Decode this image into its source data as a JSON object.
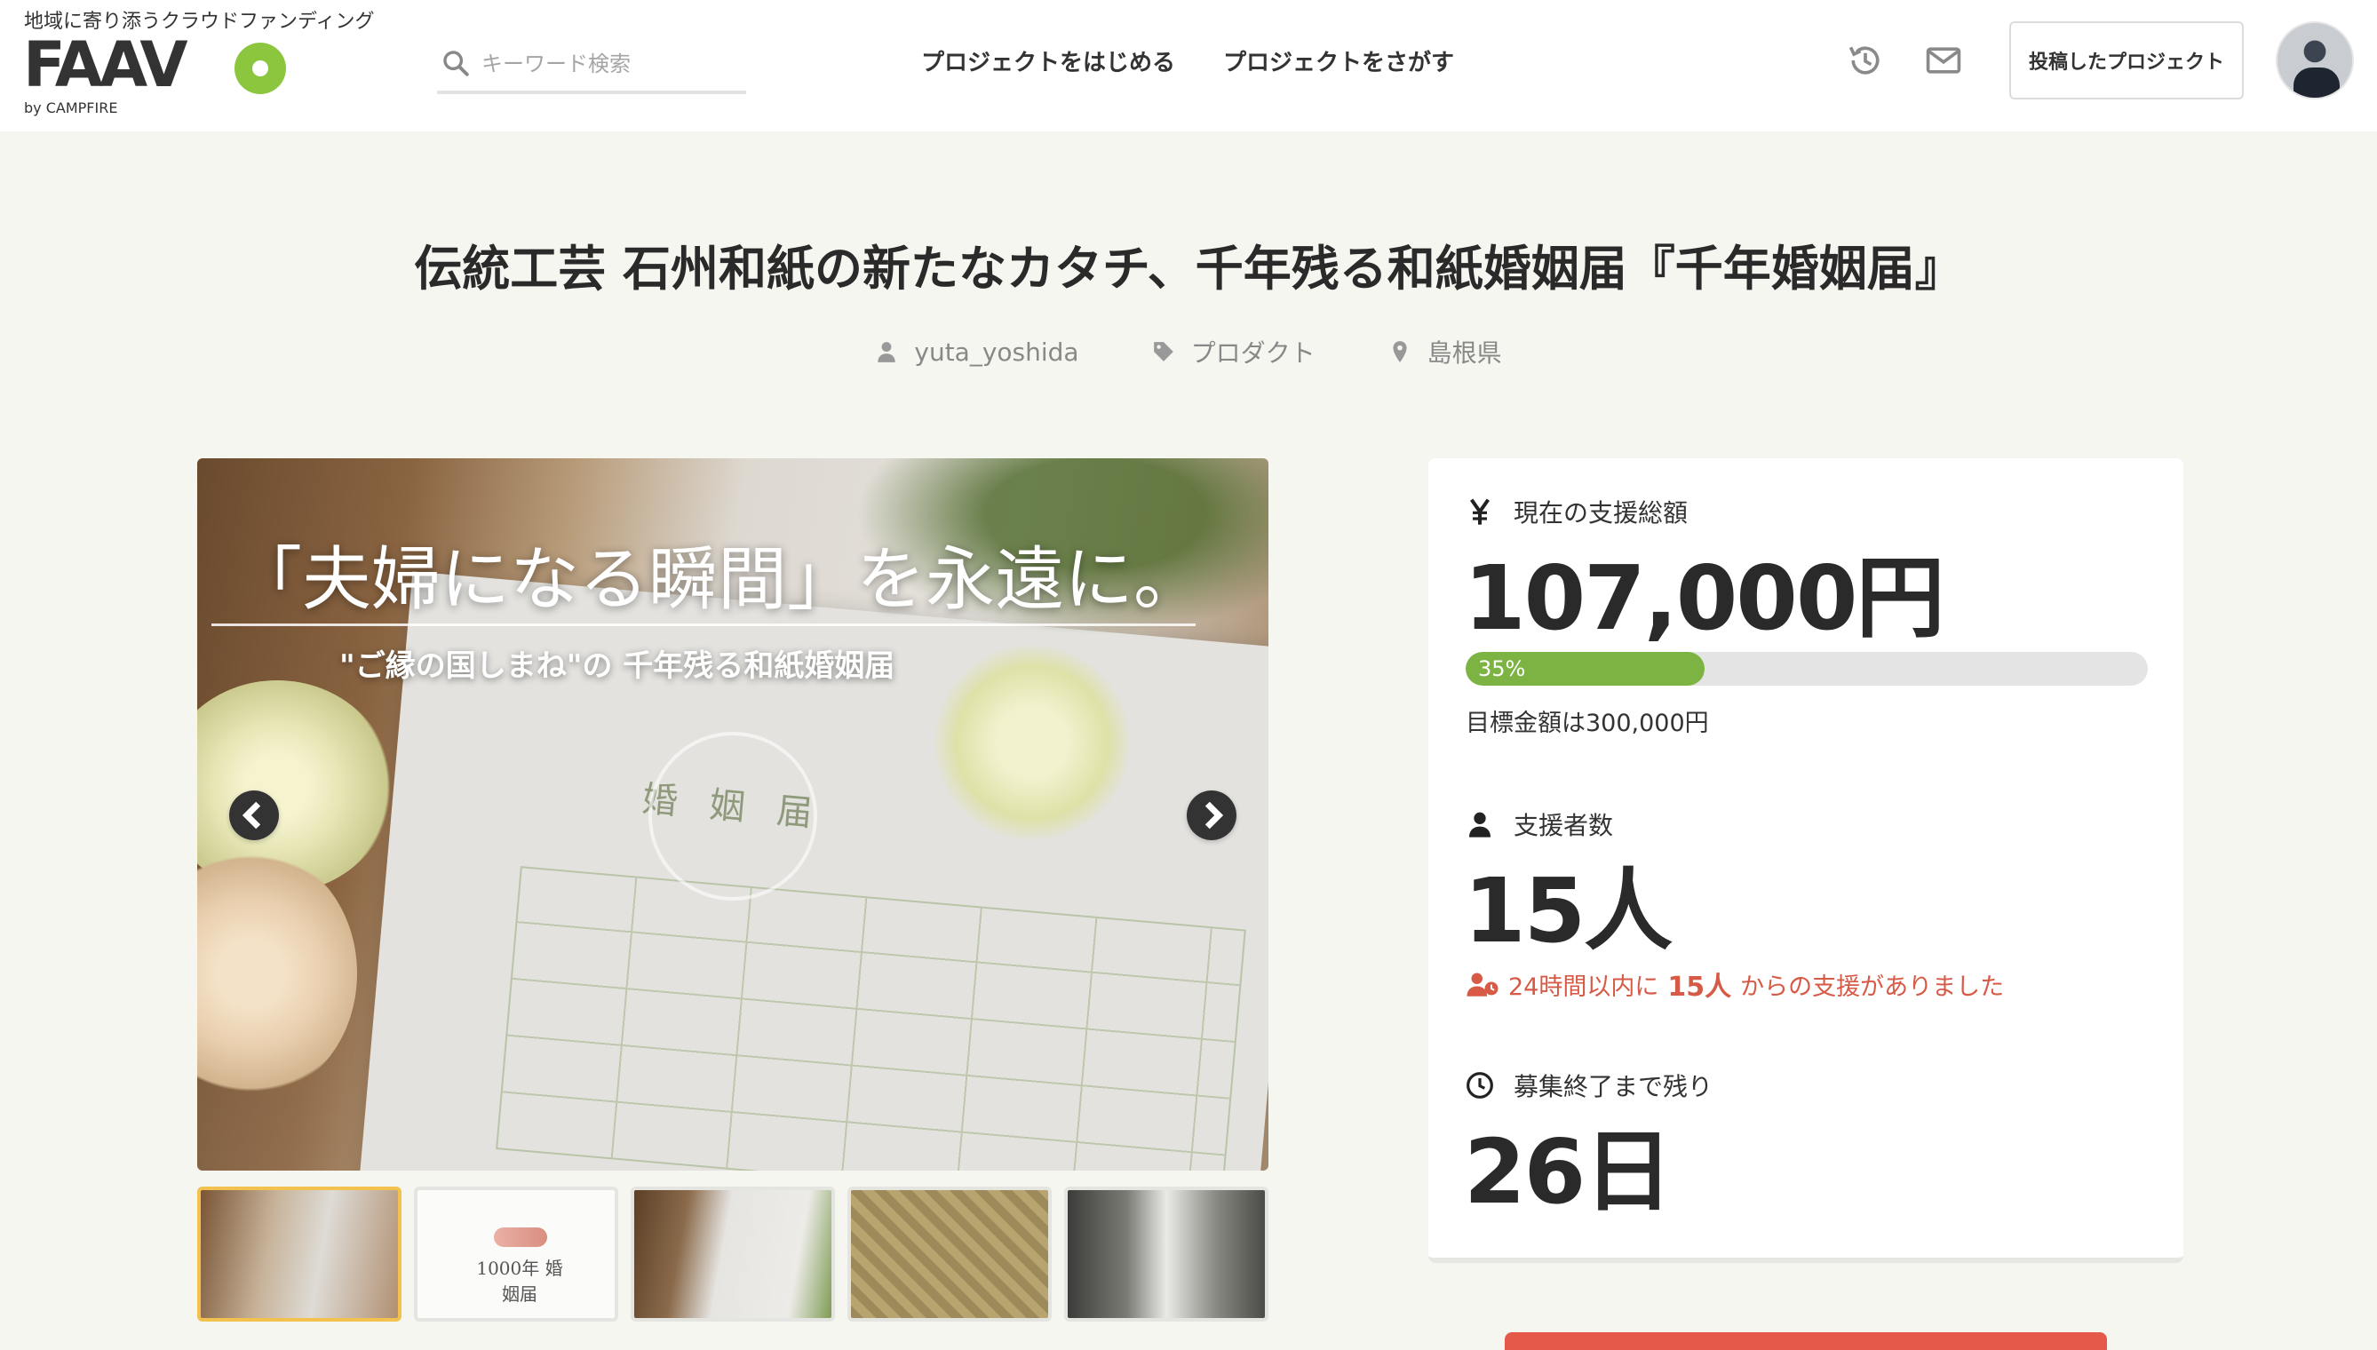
{
  "header": {
    "tagline": "地域に寄り添うクラウドファンディング",
    "logo_text": "FAAV",
    "logo_sub": "by CAMPFIRE",
    "search_placeholder": "キーワード検索",
    "nav": [
      "プロジェクトをはじめる",
      "プロジェクトをさがす"
    ],
    "icons": [
      "history-icon",
      "mail-icon"
    ],
    "posted_button": "投稿したプロジェクト"
  },
  "project": {
    "title": "伝統工芸 石州和紙の新たなカタチ、千年残る和紙婚姻届『千年婚姻届』",
    "author": "yuta_yoshida",
    "category": "プロダクト",
    "location": "島根県"
  },
  "slider": {
    "heading": "「夫婦になる瞬間」を永遠に。",
    "subheading": "\"ご縁の国しまね\"の 千年残る和紙婚姻届",
    "paper_title": "婚姻届",
    "thumb2_label": "1000年 婚姻届",
    "active_index": 0,
    "thumbnail_count": 5
  },
  "stats": {
    "total_label": "現在の支援総額",
    "total_value": "107,000円",
    "progress_percent": 35,
    "progress_label": "35%",
    "goal_text": "目標金額は300,000円",
    "supporters_label": "支援者数",
    "supporters_value": "15人",
    "recent_prefix": "24時間以内に",
    "recent_count": "15人",
    "recent_suffix": "からの支援がありました",
    "remaining_label": "募集終了まで残り",
    "remaining_value": "26日"
  },
  "colors": {
    "accent_green": "#8cc63f",
    "progress_green": "#7cb342",
    "alert_red": "#d75a46",
    "cta_red": "#e5594a",
    "thumb_active": "#f2c14e"
  }
}
